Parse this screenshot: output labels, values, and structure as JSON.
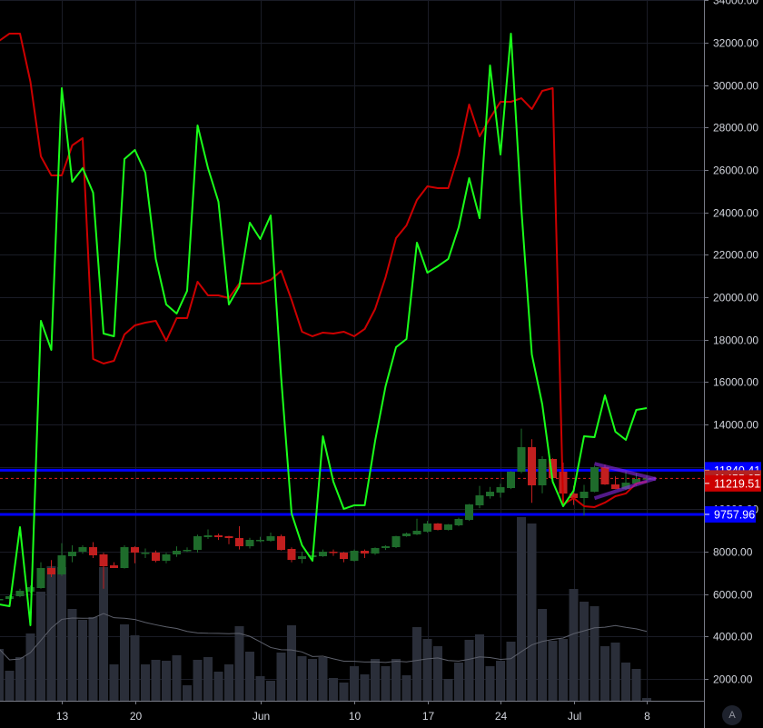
{
  "chart_data": {
    "type": "candlestick",
    "price_axis": {
      "ylim": [
        1000,
        34000
      ],
      "ticks": [
        "2000.00",
        "4000.00",
        "6000.00",
        "8000.00",
        "10000.00",
        "12000.00",
        "14000.00",
        "16000.00",
        "18000.00",
        "20000.00",
        "22000.00",
        "24000.00",
        "26000.00",
        "28000.00",
        "30000.00",
        "32000.00",
        "34000.00"
      ]
    },
    "date_axis": {
      "ticks": [
        {
          "date": "05-13",
          "label": "13"
        },
        {
          "date": "05-20",
          "label": "20"
        },
        {
          "date": "06-01",
          "label": "Jun"
        },
        {
          "date": "06-10",
          "label": "10"
        },
        {
          "date": "06-17",
          "label": "17"
        },
        {
          "date": "06-24",
          "label": "24"
        },
        {
          "date": "07-01",
          "label": "Jul"
        },
        {
          "date": "07-08",
          "label": "8"
        }
      ]
    },
    "grid": true,
    "candle_fields": [
      "date",
      "open",
      "high",
      "low",
      "close",
      "volume"
    ],
    "candles": [
      [
        "05-07",
        5726,
        5800,
        5650,
        5769,
        2486
      ],
      [
        "05-08",
        5769,
        5950,
        5700,
        5898,
        1457
      ],
      [
        "05-09",
        5898,
        6250,
        5850,
        6155,
        2100
      ],
      [
        "05-10",
        6112,
        6400,
        6050,
        6326,
        3215
      ],
      [
        "05-11",
        6284,
        7500,
        6250,
        7227,
        5186
      ],
      [
        "05-12",
        7227,
        7600,
        6800,
        6927,
        6386
      ],
      [
        "05-13",
        6927,
        8400,
        6850,
        7827,
        6343
      ],
      [
        "05-14",
        7784,
        8300,
        7500,
        7999,
        4372
      ],
      [
        "05-15",
        7999,
        8300,
        7900,
        8212,
        3857
      ],
      [
        "05-16",
        8212,
        8450,
        7700,
        7827,
        3986
      ],
      [
        "05-17",
        7869,
        7950,
        6250,
        7312,
        6343
      ],
      [
        "05-18",
        7355,
        7500,
        7250,
        7227,
        1757
      ],
      [
        "05-19",
        7227,
        8300,
        7200,
        8212,
        3643
      ],
      [
        "05-20",
        8212,
        8250,
        7450,
        7955,
        3129
      ],
      [
        "05-21",
        7955,
        8150,
        7700,
        7955,
        1757
      ],
      [
        "05-22",
        7955,
        8050,
        7500,
        7569,
        1972
      ],
      [
        "05-23",
        7569,
        7950,
        7450,
        7869,
        1929
      ],
      [
        "05-24",
        7869,
        8250,
        7750,
        8041,
        2186
      ],
      [
        "05-25",
        8041,
        8200,
        7980,
        8084,
        771
      ],
      [
        "05-26",
        8084,
        8800,
        7950,
        8727,
        1972
      ],
      [
        "05-27",
        8684,
        9050,
        8600,
        8769,
        2100
      ],
      [
        "05-28",
        8769,
        8850,
        8550,
        8684,
        1414
      ],
      [
        "05-29",
        8727,
        8750,
        8350,
        8641,
        1757
      ],
      [
        "05-30",
        8641,
        9200,
        8100,
        8255,
        3557
      ],
      [
        "05-31",
        8255,
        8650,
        8150,
        8555,
        2357
      ],
      [
        "06-01",
        8555,
        8700,
        8450,
        8555,
        1200
      ],
      [
        "06-02",
        8513,
        8900,
        8470,
        8727,
        986
      ],
      [
        "06-03",
        8727,
        8800,
        8060,
        8084,
        2314
      ],
      [
        "06-04",
        8127,
        8200,
        7500,
        7612,
        3600
      ],
      [
        "06-05",
        7655,
        8000,
        7450,
        7784,
        2143
      ],
      [
        "06-06",
        7741,
        8050,
        7700,
        7827,
        2014
      ],
      [
        "06-07",
        7784,
        8100,
        7750,
        7999,
        2100
      ],
      [
        "06-08",
        7999,
        8100,
        7800,
        7955,
        1114
      ],
      [
        "06-09",
        7955,
        7990,
        7500,
        7655,
        900
      ],
      [
        "06-10",
        7569,
        8100,
        7530,
        8041,
        1671
      ],
      [
        "06-11",
        8041,
        8100,
        7700,
        7912,
        1286
      ],
      [
        "06-12",
        7912,
        8200,
        7850,
        8170,
        2014
      ],
      [
        "06-13",
        8170,
        8300,
        8080,
        8255,
        1671
      ],
      [
        "06-14",
        8212,
        8750,
        8170,
        8727,
        2014
      ],
      [
        "06-15",
        8727,
        8900,
        8700,
        8856,
        1243
      ],
      [
        "06-16",
        8813,
        9550,
        8780,
        8985,
        3514
      ],
      [
        "06-17",
        8942,
        9450,
        8900,
        9327,
        2957
      ],
      [
        "06-18",
        9327,
        9350,
        9000,
        9027,
        2614
      ],
      [
        "06-19",
        9027,
        9300,
        9000,
        9284,
        1071
      ],
      [
        "06-20",
        9241,
        9600,
        9200,
        9541,
        1843
      ],
      [
        "06-21",
        9498,
        10250,
        9450,
        10227,
        2914
      ],
      [
        "06-22",
        10184,
        11100,
        10050,
        10655,
        3172
      ],
      [
        "06-23",
        10612,
        11050,
        10500,
        10827,
        1671
      ],
      [
        "06-24",
        10784,
        11200,
        10550,
        11041,
        1929
      ],
      [
        "06-25",
        10998,
        11800,
        10950,
        11770,
        2829
      ],
      [
        "06-26",
        11770,
        13800,
        11700,
        12927,
        8700
      ],
      [
        "06-27",
        12927,
        13300,
        10300,
        11127,
        8400
      ],
      [
        "06-28",
        11127,
        12500,
        10750,
        12370,
        4372
      ],
      [
        "06-29",
        12370,
        12400,
        11850,
        11470,
        2871
      ],
      [
        "06-30",
        11770,
        12200,
        10140,
        10741,
        2957
      ],
      [
        "07-01",
        10741,
        11100,
        10200,
        10527,
        5314
      ],
      [
        "07-02",
        10527,
        11150,
        9700,
        10827,
        4714
      ],
      [
        "07-03",
        10827,
        12050,
        10800,
        11984,
        4500
      ],
      [
        "07-04",
        11984,
        12100,
        11150,
        11170,
        2614
      ],
      [
        "07-05",
        11170,
        11550,
        10950,
        10955,
        2786
      ],
      [
        "07-06",
        10955,
        11800,
        10900,
        11253,
        1843
      ],
      [
        "07-07",
        11212,
        11700,
        11100,
        11427,
        1543
      ],
      [
        "07-08",
        11455,
        11600,
        11300,
        11455,
        171
      ]
    ],
    "green_line": [
      5513,
      5427,
      9156,
      4527,
      18885,
      17513,
      29857,
      25442,
      26085,
      24928,
      18285,
      18157,
      26514,
      26943,
      25871,
      21800,
      19657,
      19228,
      20300,
      28100,
      26085,
      24500,
      19657,
      20514,
      23514,
      22743,
      23857,
      16228,
      9800,
      8300,
      7570,
      13442,
      11300,
      10014,
      10185,
      10185,
      13228,
      15800,
      17642,
      18028,
      22571,
      21157,
      21457,
      21800,
      23300,
      25614,
      23728,
      30929,
      26728,
      32428,
      24157,
      17300,
      14942,
      11300,
      10143,
      10871,
      13442,
      13400,
      15371,
      13657,
      13271,
      14685,
      14770
    ],
    "red_line": [
      32086,
      32429,
      32429,
      30157,
      26643,
      25743,
      25743,
      27157,
      27500,
      17085,
      16871,
      17000,
      18242,
      18671,
      18800,
      18885,
      17943,
      19014,
      19014,
      20728,
      20085,
      20085,
      19957,
      20643,
      20643,
      20643,
      20814,
      21243,
      19871,
      18371,
      18157,
      18328,
      18285,
      18371,
      18157,
      18500,
      19443,
      20942,
      22785,
      23385,
      24585,
      25228,
      25142,
      25142,
      26728,
      29085,
      27585,
      28443,
      29214,
      29214,
      29385,
      28871,
      29728,
      29857,
      10227,
      10528,
      10143,
      10100,
      10314,
      10614,
      10743,
      11214,
      11300
    ],
    "horizontal_levels": [
      {
        "price": 11840.41,
        "label": "11840.41",
        "color": "#0000ff"
      },
      {
        "price": 9757.96,
        "label": "9757.96",
        "color": "#0000ff"
      }
    ],
    "price_tags": [
      {
        "price": 11840.41,
        "label": "11840.41",
        "color": "#0000ff"
      },
      {
        "price": 11455.27,
        "label": "11455.27",
        "color": "#b22222"
      },
      {
        "price": 11219.51,
        "label": "11219.51",
        "color": "#cc0000"
      },
      {
        "price": 9757.96,
        "label": "9757.96",
        "color": "#0000ff"
      }
    ],
    "last_price": 11455.27,
    "trendlines": [
      {
        "from": [
          "07-03",
          12150
        ],
        "to": [
          "07-08",
          11420
        ],
        "color": "#8a2be2"
      },
      {
        "from": [
          "07-03",
          10520
        ],
        "to": [
          "07-08",
          11460
        ],
        "color": "#8a2be2"
      }
    ],
    "volume_ma_period": 20,
    "colors": {
      "up": "#1e6b2b",
      "down": "#c21f1f",
      "volume": "#2a2e39",
      "green_line": "#1aff1a",
      "red_line": "#cc0000",
      "grid": "#1a1c26",
      "background": "#000000"
    }
  },
  "controls": {
    "auto_scale_label": "A"
  }
}
